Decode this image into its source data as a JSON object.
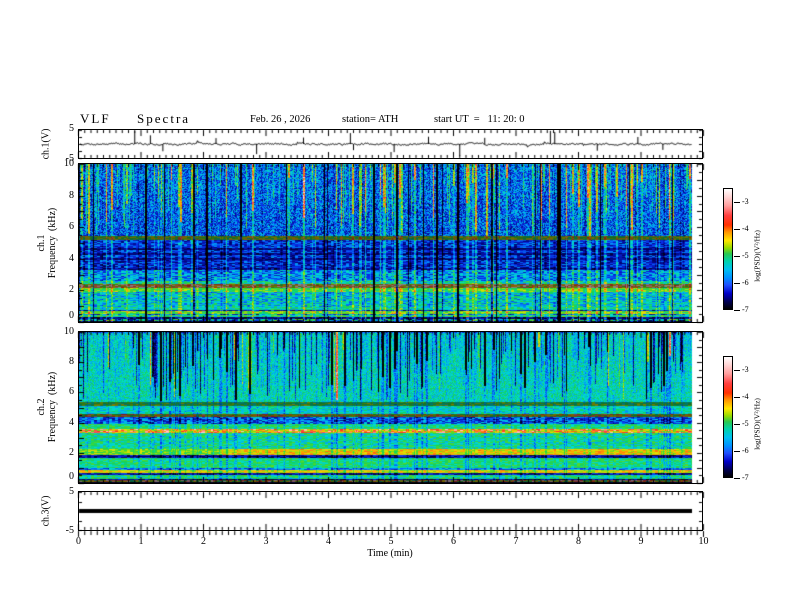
{
  "header": {
    "title": "VLF  Spectra",
    "date": "Feb. 26 , 2026",
    "station": "station= ATH",
    "start_ut": "start UT  =   11: 20: 0"
  },
  "axes": {
    "time": {
      "label": "Time  (min)",
      "ticks": [
        0,
        1,
        2,
        3,
        4,
        5,
        6,
        7,
        8,
        9,
        10
      ],
      "range": [
        0,
        10
      ]
    },
    "ch1v": {
      "label": "ch.1(V)",
      "ticks": [
        5,
        -5
      ],
      "range": [
        -5,
        5
      ]
    },
    "ch1f": {
      "label_line1": "ch.1",
      "label_line2": "Frequency  (kHz)",
      "ticks": [
        10,
        8,
        6,
        4,
        2,
        0
      ],
      "range": [
        0,
        10
      ]
    },
    "ch2f": {
      "label_line1": "ch.2",
      "label_line2": "Frequency  (kHz)",
      "ticks": [
        10,
        8,
        6,
        4,
        2,
        0
      ],
      "range": [
        0,
        10
      ]
    },
    "ch3v": {
      "label": "ch.3(V)",
      "ticks": [
        5,
        -5
      ],
      "range": [
        -5,
        5
      ]
    }
  },
  "colorbar": {
    "label": "log(PSD)(V²/Hz)",
    "ticks": [
      -3,
      -4,
      -5,
      -6,
      -7
    ],
    "gradient_stops": [
      [
        0,
        "#ffffff"
      ],
      [
        7,
        "#ffd2d2"
      ],
      [
        14,
        "#ff9e9e"
      ],
      [
        22,
        "#ff4040"
      ],
      [
        30,
        "#ff3000"
      ],
      [
        36,
        "#ff9600"
      ],
      [
        43,
        "#ffe600"
      ],
      [
        49,
        "#96dc00"
      ],
      [
        54,
        "#28c850"
      ],
      [
        60,
        "#00d2aa"
      ],
      [
        67,
        "#00c0f0"
      ],
      [
        74,
        "#0090ff"
      ],
      [
        80,
        "#2050ff"
      ],
      [
        87,
        "#0000c8"
      ],
      [
        94,
        "#000050"
      ],
      [
        100,
        "#000000"
      ]
    ]
  },
  "chart_data": {
    "type": "heatmap",
    "title": "VLF Spectra",
    "date": "Feb. 26, 2026",
    "station": "ATH",
    "start_ut": "11:20:0",
    "x": {
      "label": "Time (min)",
      "range": [
        0,
        10
      ],
      "ticks": [
        0,
        1,
        2,
        3,
        4,
        5,
        6,
        7,
        8,
        9,
        10
      ],
      "data_end_min": 9.84
    },
    "colorbar": {
      "label": "log(PSD)(V²/Hz)",
      "ticks": [
        -3,
        -4,
        -5,
        -6,
        -7
      ],
      "units": "log10 PSD V^2/Hz"
    },
    "palette": [
      [
        0,
        0,
        0,
        0
      ],
      [
        0.1,
        0,
        0,
        110
      ],
      [
        0.22,
        10,
        40,
        230
      ],
      [
        0.32,
        0,
        140,
        255
      ],
      [
        0.42,
        0,
        220,
        210
      ],
      [
        0.52,
        20,
        210,
        90
      ],
      [
        0.62,
        110,
        220,
        20
      ],
      [
        0.7,
        230,
        225,
        0
      ],
      [
        0.78,
        255,
        160,
        0
      ],
      [
        0.86,
        255,
        40,
        40
      ],
      [
        0.93,
        255,
        150,
        150
      ],
      [
        1,
        255,
        235,
        235
      ]
    ],
    "panels": [
      {
        "id": "ch1v",
        "kind": "waveform",
        "ylabel": "ch.1(V)",
        "ylim": [
          -5,
          5
        ],
        "baseline": 0,
        "noise_amp": 0.45,
        "spikes": [
          [
            0.9,
            4.6
          ],
          [
            1.15,
            3.1
          ],
          [
            1.35,
            -2.6
          ],
          [
            2.2,
            2.1
          ],
          [
            2.85,
            -3.6
          ],
          [
            3.6,
            2.3
          ],
          [
            4.35,
            3.9
          ],
          [
            4.4,
            -2.2
          ],
          [
            5.05,
            -2.9
          ],
          [
            5.6,
            2.6
          ],
          [
            6.1,
            -4.2
          ],
          [
            6.5,
            2.2
          ],
          [
            7.55,
            4.7
          ],
          [
            7.62,
            4.3
          ],
          [
            8.3,
            -2.4
          ],
          [
            8.95,
            2.5
          ],
          [
            9.35,
            -2.1
          ]
        ]
      },
      {
        "id": "ch1f",
        "kind": "spectrogram",
        "ylabel": "ch.1 Frequency (kHz)",
        "ylim": [
          0,
          10
        ],
        "seed": 11,
        "streaks": {
          "mode": "bright",
          "region_start_khz": 5.45,
          "density": 0.11
        },
        "bands": [
          [
            0,
            0.12,
            0.03,
            0.02
          ],
          [
            0.12,
            0.22,
            0.35,
            0.3
          ],
          [
            0.22,
            0.32,
            0.1,
            0.1
          ],
          [
            0.32,
            0.45,
            0.5,
            0.15
          ],
          [
            0.45,
            0.55,
            0.3,
            0.2
          ],
          [
            0.55,
            0.7,
            0.6,
            0.12
          ],
          [
            0.7,
            0.8,
            0.18,
            0.12
          ],
          [
            0.8,
            0.95,
            0.45,
            0.12
          ],
          [
            0.95,
            1.9,
            0.4,
            0.15
          ],
          [
            1.9,
            2.18,
            0.58,
            0.12
          ],
          [
            2.18,
            2.42,
            0.8,
            0.25,
            0.55
          ],
          [
            2.42,
            2.6,
            0.45,
            0.15
          ],
          [
            2.6,
            3.3,
            0.32,
            0.15
          ],
          [
            3.3,
            3.45,
            0.13,
            0.1
          ],
          [
            3.45,
            3.95,
            0.21,
            0.13
          ],
          [
            3.95,
            4.08,
            0.11,
            0.07
          ],
          [
            4.08,
            4.3,
            0.21,
            0.13
          ],
          [
            4.3,
            4.42,
            0.11,
            0.07
          ],
          [
            4.42,
            4.6,
            0.21,
            0.13
          ],
          [
            4.6,
            4.72,
            0.11,
            0.07
          ],
          [
            4.72,
            5.25,
            0.22,
            0.13
          ],
          [
            5.25,
            5.45,
            0.62,
            0.15,
            0.5
          ],
          [
            5.45,
            10,
            0.26,
            0.15
          ]
        ]
      },
      {
        "id": "ch2f",
        "kind": "spectrogram",
        "ylabel": "ch.2 Frequency (kHz)",
        "ylim": [
          0,
          10
        ],
        "seed": 29,
        "streaks": {
          "mode": "dark",
          "region_start_khz": 5.42,
          "density": 0.12
        },
        "bands": [
          [
            0,
            0.1,
            0.03,
            0.02
          ],
          [
            0.1,
            0.2,
            0.75,
            0.3,
            0.5
          ],
          [
            0.2,
            0.3,
            0.12,
            0.1
          ],
          [
            0.3,
            0.55,
            0.48,
            0.12
          ],
          [
            0.55,
            0.7,
            0.16,
            0.1
          ],
          [
            0.7,
            0.92,
            0.7,
            0.1
          ],
          [
            0.92,
            1.05,
            0.32,
            0.12
          ],
          [
            1.05,
            1.72,
            0.5,
            0.1
          ],
          [
            1.72,
            1.92,
            0.15,
            0.1
          ],
          [
            1.92,
            2.28,
            0.62,
            0.1,
            1,
            2.25,
            0.1
          ],
          [
            2.28,
            3.35,
            0.47,
            0.12
          ],
          [
            3.35,
            3.58,
            0.78,
            0.2
          ],
          [
            3.58,
            3.95,
            0.5,
            0.1
          ],
          [
            3.95,
            4.42,
            0.27,
            0.15
          ],
          [
            4.42,
            4.62,
            0.72,
            0.22,
            0.5
          ],
          [
            4.62,
            5.15,
            0.43,
            0.1
          ],
          [
            5.15,
            5.42,
            0.55,
            0.15,
            0.55
          ],
          [
            5.42,
            10,
            0.44,
            0.1
          ]
        ]
      },
      {
        "id": "ch3v",
        "kind": "flatline",
        "ylabel": "ch.3(V)",
        "ylim": [
          -5,
          5
        ],
        "value": 0,
        "thickness_px": 4
      }
    ]
  }
}
